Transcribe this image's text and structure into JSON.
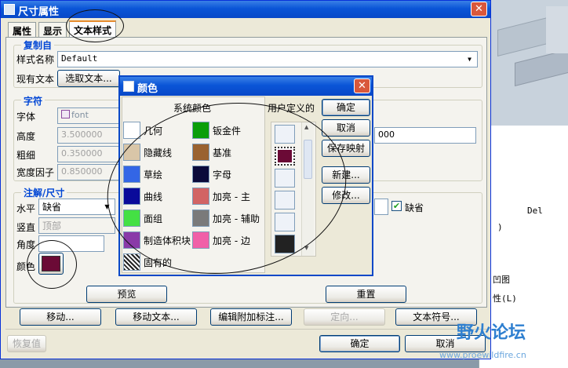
{
  "dialog": {
    "title": "尺寸属性",
    "tabs": [
      "属性",
      "显示",
      "文本样式"
    ],
    "copy_from": {
      "title": "复制自",
      "style_name_label": "样式名称",
      "style_name_value": "Default",
      "existing_text_label": "现有文本",
      "select_text_button": "选取文本..."
    },
    "character": {
      "title": "字符",
      "font_label": "字体",
      "font_value": "font",
      "height_label": "高度",
      "height_value": "3.500000",
      "thickness_label": "粗细",
      "thickness_value": "0.350000",
      "width_factor_label": "宽度因子",
      "width_factor_value": "0.850000",
      "right_field_value": "000"
    },
    "note": {
      "title": "注解/尺寸",
      "horizontal_label": "水平",
      "horizontal_value": "缺省",
      "vertical_label": "竖直",
      "vertical_value": "顶部",
      "angle_label": "角度",
      "color_label": "颜色",
      "default_checkbox_label": "缺省"
    },
    "preview_button": "预览",
    "reset_button": "重置",
    "bottom_buttons": [
      "移动...",
      "移动文本...",
      "编辑附加标注...",
      "定向...",
      "文本符号..."
    ],
    "restore_button": "恢复值",
    "ok_button": "确定",
    "cancel_button": "取消"
  },
  "color_popup": {
    "title": "颜色",
    "system_colors_label": "系统颜色",
    "user_defined_label": "用户定义的",
    "system_colors": [
      {
        "name": "几何",
        "color": "#ffffff"
      },
      {
        "name": "钣金件",
        "color": "#0a9e0a"
      },
      {
        "name": "隐藏线",
        "color": "#d9c6a8"
      },
      {
        "name": "基准",
        "color": "#9a6230"
      },
      {
        "name": "草绘",
        "color": "#3366e6"
      },
      {
        "name": "字母",
        "color": "#0a0a3a"
      },
      {
        "name": "曲线",
        "color": "#0a0a9a"
      },
      {
        "name": "加亮 - 主",
        "color": "#d26464"
      },
      {
        "name": "面组",
        "color": "#44e044"
      },
      {
        "name": "加亮 - 辅助",
        "color": "#7a7a7a"
      },
      {
        "name": "制造体积块",
        "color": "#8a3aa8"
      },
      {
        "name": "加亮 - 边",
        "color": "#f060a8"
      },
      {
        "name": "固有的",
        "color": "hatch"
      }
    ],
    "user_colors": [
      "#eef2f8",
      "#6b0a36",
      "#eef2f8",
      "#eef2f8",
      "#eef2f8",
      "#222222"
    ],
    "buttons": [
      "确定",
      "取消",
      "保存映射",
      "新建...",
      "修改..."
    ]
  },
  "selected_color": "#6b0a36",
  "background": {
    "text_lines": [
      "Del",
      ")",
      "凹图",
      "性(L)"
    ]
  },
  "watermark": {
    "title": "野火论坛",
    "url": "www.proewildfire.cn"
  }
}
